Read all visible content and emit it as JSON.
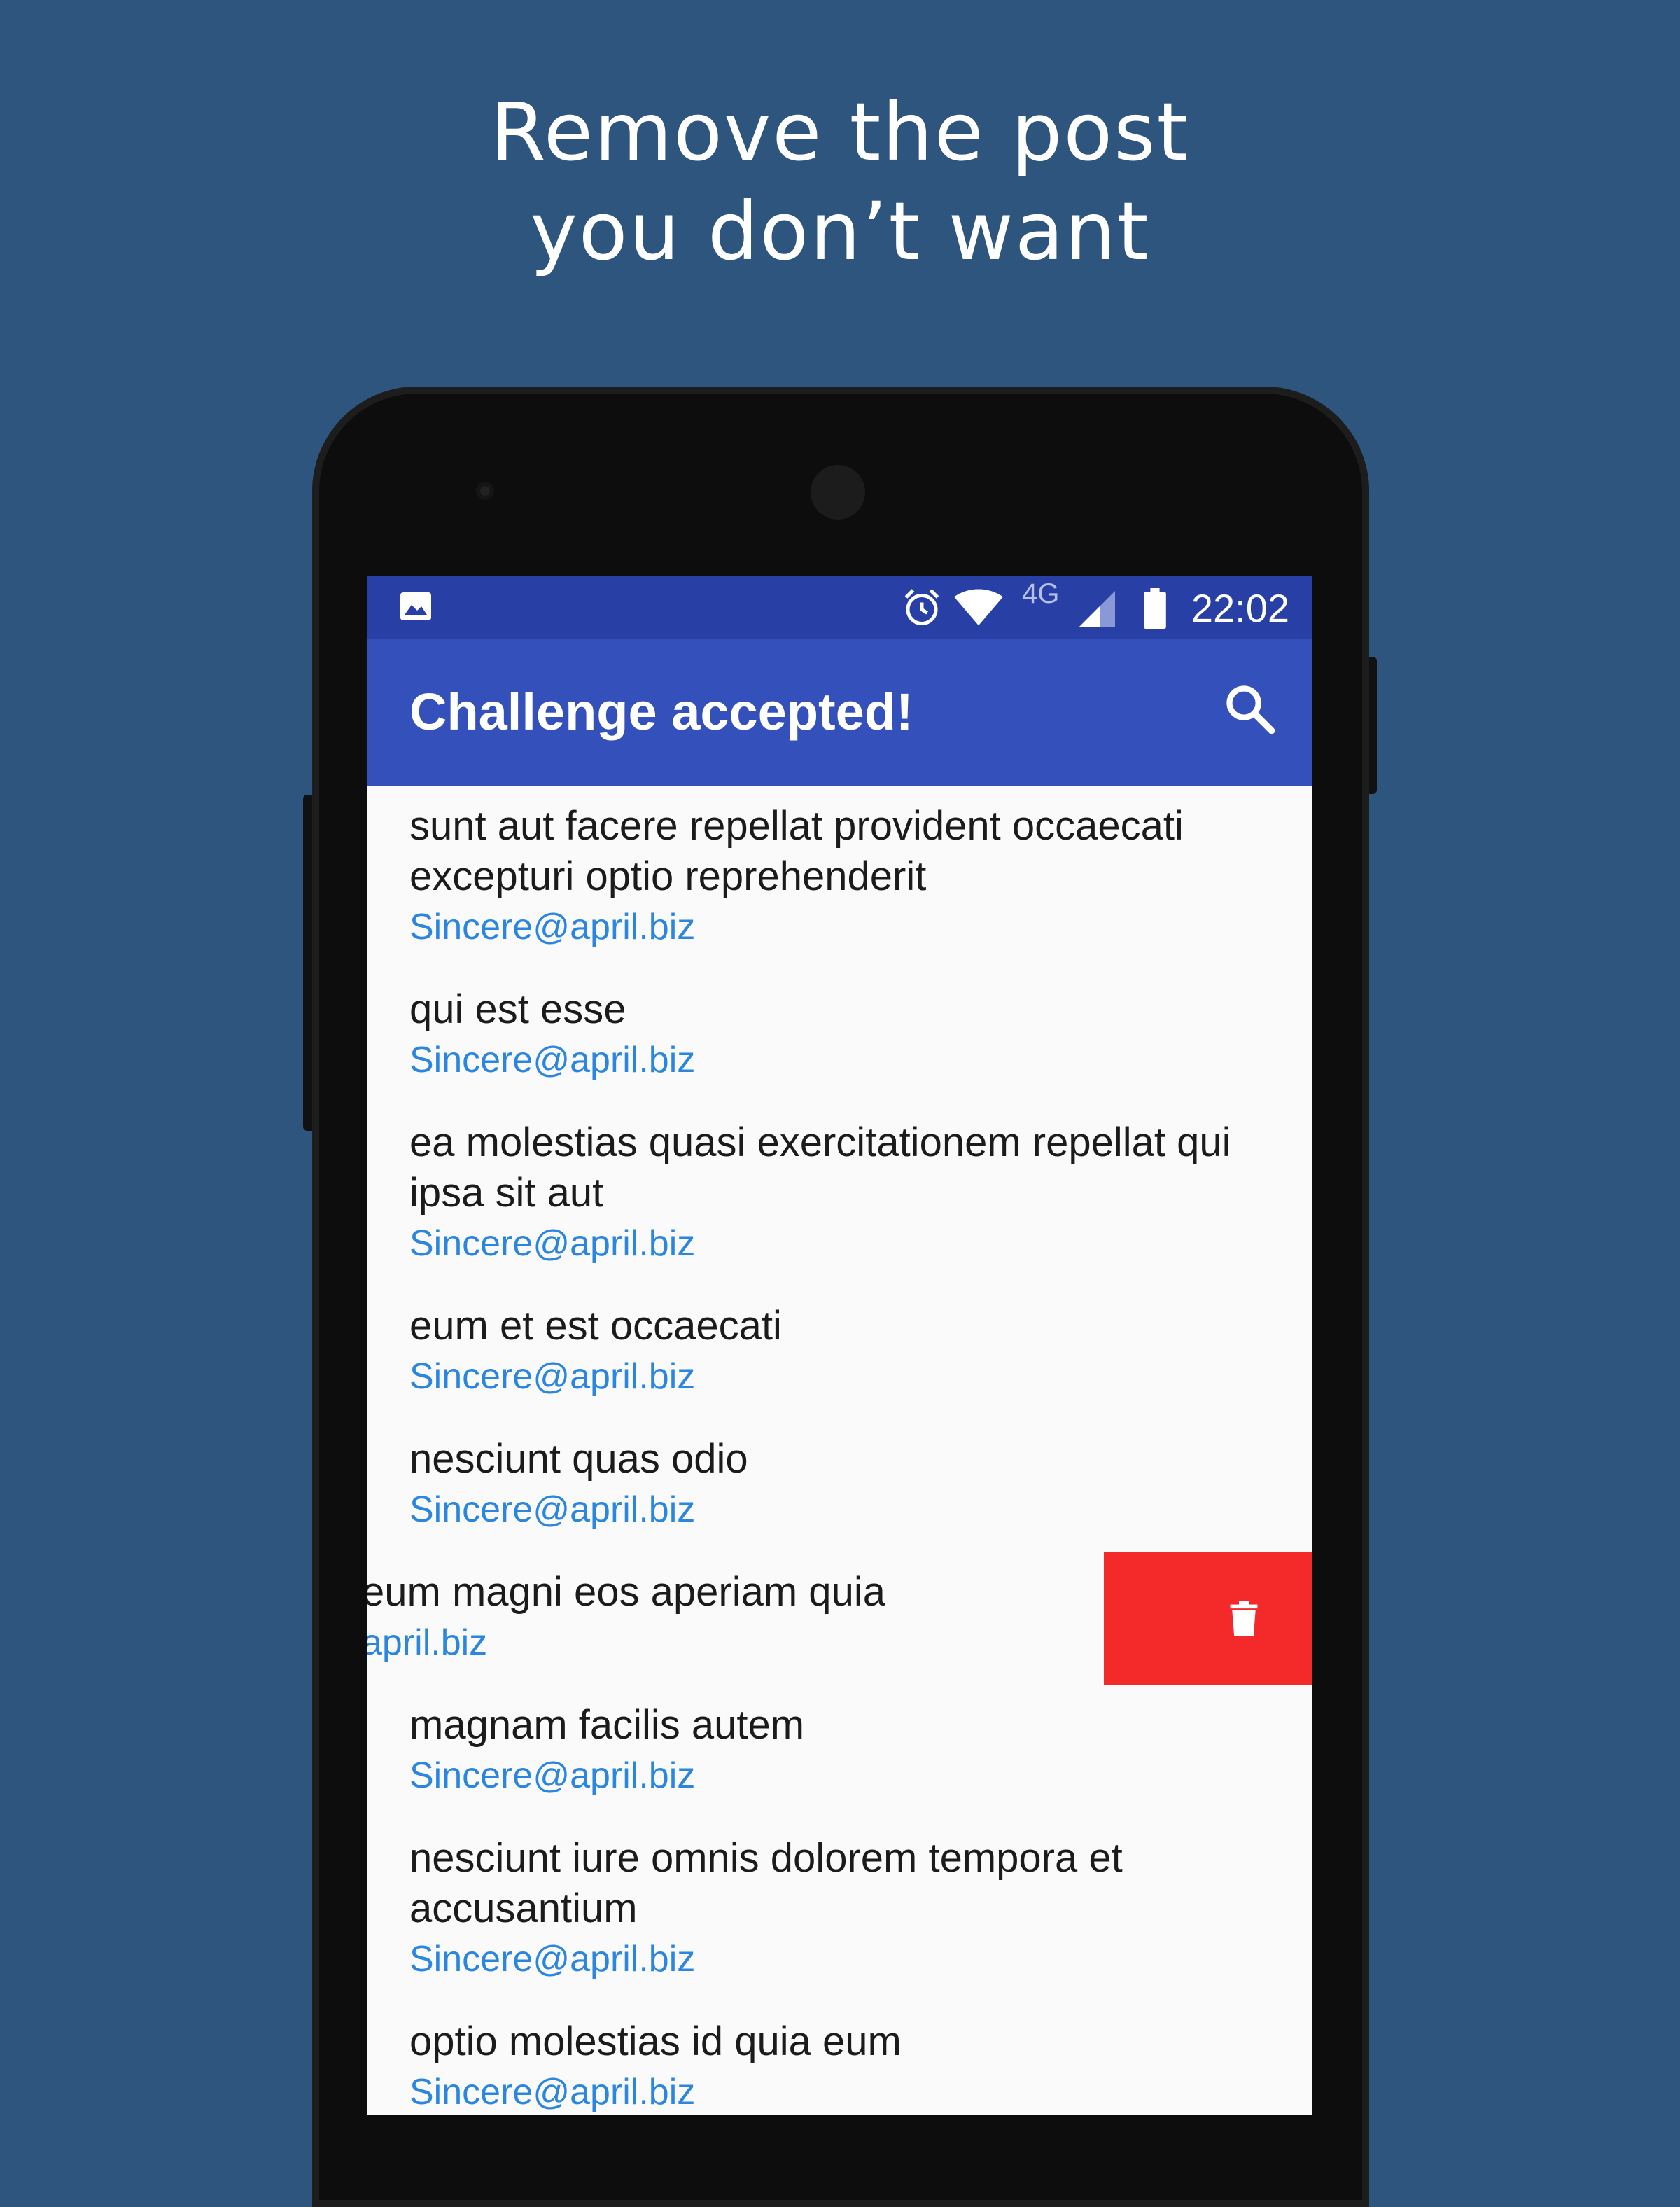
{
  "headline": {
    "line1": "Remove the post",
    "line2": "you don’t want"
  },
  "statusbar": {
    "network": "4G",
    "time": "22:02"
  },
  "toolbar": {
    "title": "Challenge accepted!"
  },
  "posts": [
    {
      "title": "sunt aut facere repellat provident occaecati excepturi optio reprehenderit",
      "email": "Sincere@april.biz"
    },
    {
      "title": "qui est esse",
      "email": "Sincere@april.biz"
    },
    {
      "title": "ea molestias quasi exercitationem repellat qui ipsa sit aut",
      "email": "Sincere@april.biz"
    },
    {
      "title": "eum et est occaecati",
      "email": "Sincere@april.biz"
    },
    {
      "title": "nesciunt quas odio",
      "email": "Sincere@april.biz"
    },
    {
      "title": "eum magni eos aperiam quia",
      "email": "april.biz"
    },
    {
      "title": "magnam facilis autem",
      "email": "Sincere@april.biz"
    },
    {
      "title": "nesciunt iure omnis dolorem tempora et accusantium",
      "email": "Sincere@april.biz"
    },
    {
      "title": "optio molestias id quia eum",
      "email": "Sincere@april.biz"
    }
  ],
  "colors": {
    "background": "#2e557e",
    "statusbar": "#283fa6",
    "toolbar": "#3450bb",
    "email_link": "#2b86e0",
    "delete_swipe": "#f42a2a"
  }
}
